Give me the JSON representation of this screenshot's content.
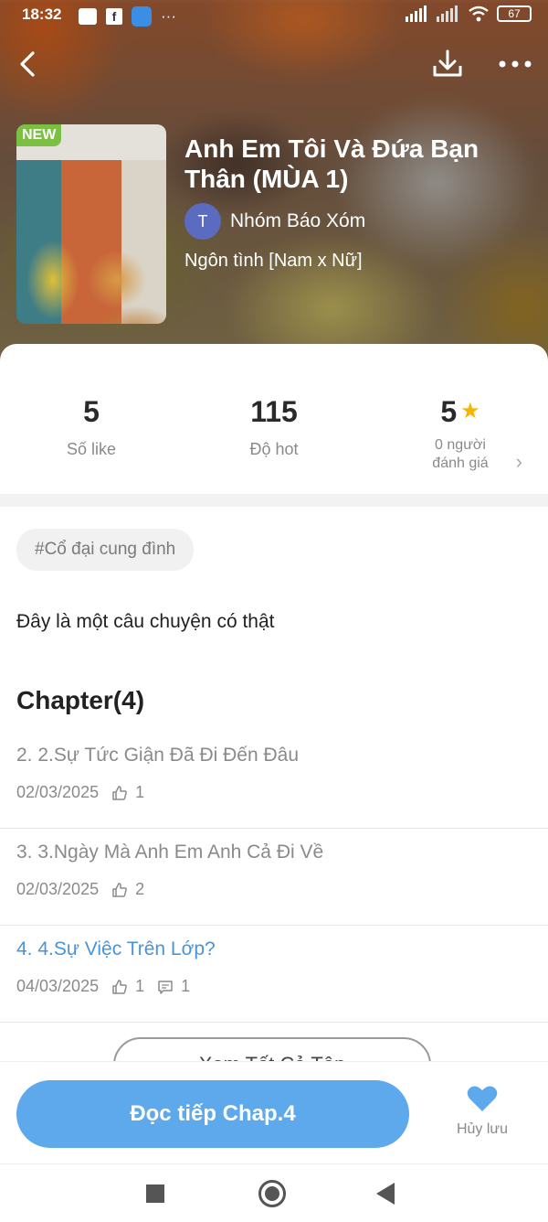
{
  "status_bar": {
    "time": "18:32",
    "more": "···",
    "battery": "67"
  },
  "header": {
    "badge": "NEW",
    "title": "Anh Em Tôi Và Đứa Bạn Thân (MÙA 1)",
    "author_initial": "T",
    "author_name": "Nhóm Báo Xóm",
    "genre": "Ngôn tình [Nam x Nữ]"
  },
  "stats": {
    "likes_value": "5",
    "likes_label": "Số like",
    "hot_value": "115",
    "hot_label": "Độ hot",
    "rating_value": "5",
    "rating_label_line1": "0 người",
    "rating_label_line2": "đánh giá"
  },
  "tag": "#Cổ đại cung đình",
  "description": "Đây là một câu chuyện có thật",
  "chapters_heading": "Chapter(4)",
  "chapters": [
    {
      "title": "2. 2.Sự Tức Giận Đã Đi Đến Đâu",
      "date": "02/03/2025",
      "likes": "1"
    },
    {
      "title": "3. 3.Ngày Mà Anh Em Anh Cả Đi Về",
      "date": "02/03/2025",
      "likes": "2"
    },
    {
      "title": "4. 4.Sự Việc Trên Lớp?",
      "date": "04/03/2025",
      "likes": "1",
      "comments": "1"
    }
  ],
  "see_all_label": "Xem Tất Cả Tập",
  "actions": {
    "continue_label": "Đọc tiếp Chap.4",
    "favorite_label": "Hủy lưu"
  },
  "colors": {
    "accent": "#5ea8ec",
    "active_chapter": "#4a94d6",
    "new_badge": "#7bc043",
    "star": "#f5b400"
  }
}
